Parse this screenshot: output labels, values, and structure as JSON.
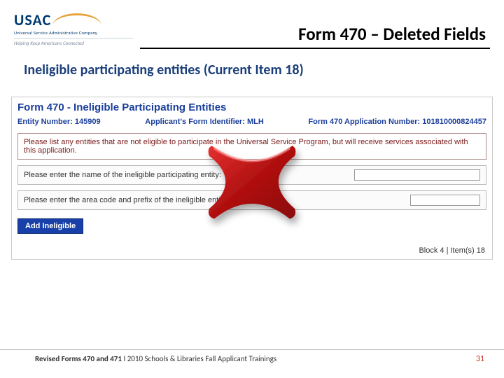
{
  "logo": {
    "main": "USAC",
    "sub": "Universal Service Administrative Company",
    "tagline": "Helping Keep Americans Connected"
  },
  "title": "Form 470 – Deleted Fields",
  "subheading": "Ineligible participating entities (Current Item 18)",
  "screenshot": {
    "heading": "Form 470 - Ineligible Participating Entities",
    "entity_label": "Entity Number:",
    "entity_value": "145909",
    "identifier_label": "Applicant's Form Identifier:",
    "identifier_value": "MLH",
    "appnum_label": "Form 470 Application Number:",
    "appnum_value": "101810000824457",
    "instruction": "Please list any entities that are not eligible to participate in the Universal Service Program, but will receive services associated with this application.",
    "row_name": "Please enter the name of the ineligible participating entity:",
    "row_area": "Please enter the area code and prefix of the ineligible entity:",
    "button": "Add Ineligible",
    "block": "Block 4 | Item(s) 18"
  },
  "footer": {
    "bold": "Revised Forms 470 and 471",
    "rest": " I 2010 Schools & Libraries Fall Applicant Trainings",
    "page": "31"
  }
}
